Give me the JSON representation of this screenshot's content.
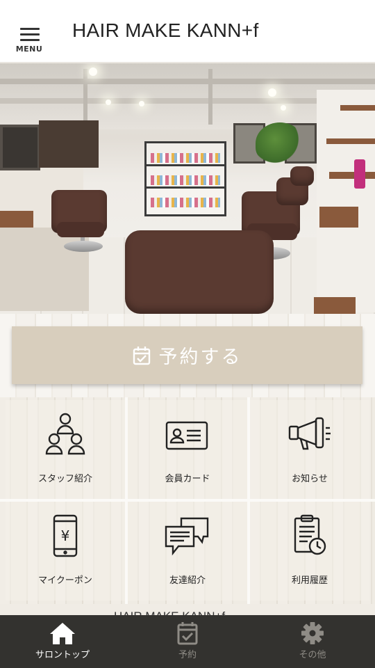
{
  "header": {
    "menu_label": "MENU",
    "title": "HAIR MAKE KANN+f"
  },
  "hero": {
    "icon": "salon-interior-photo"
  },
  "reserve": {
    "label": "予約する",
    "icon": "calendar-check-icon"
  },
  "grid": {
    "items": [
      {
        "label": "スタッフ紹介",
        "icon": "staff-icon"
      },
      {
        "label": "会員カード",
        "icon": "member-card-icon"
      },
      {
        "label": "お知らせ",
        "icon": "megaphone-icon"
      },
      {
        "label": "マイクーポン",
        "icon": "coupon-phone-icon"
      },
      {
        "label": "友達紹介",
        "icon": "chat-bubbles-icon"
      },
      {
        "label": "利用履歴",
        "icon": "history-clipboard-icon"
      }
    ]
  },
  "footer_peek": {
    "text": "HAIR MAKE KANN+f"
  },
  "tabbar": {
    "items": [
      {
        "label": "サロントップ",
        "icon": "home-icon",
        "active": true
      },
      {
        "label": "予約",
        "icon": "calendar-check-icon",
        "active": false
      },
      {
        "label": "その他",
        "icon": "gear-icon",
        "active": false
      }
    ]
  },
  "colors": {
    "header_bg": "#ffffff",
    "reserve_button": "#d8cebd",
    "tabbar_bg": "#33322f",
    "tab_active": "#ffffff",
    "tab_inactive": "#8f8c86",
    "grid_bg": "#efebe3"
  }
}
